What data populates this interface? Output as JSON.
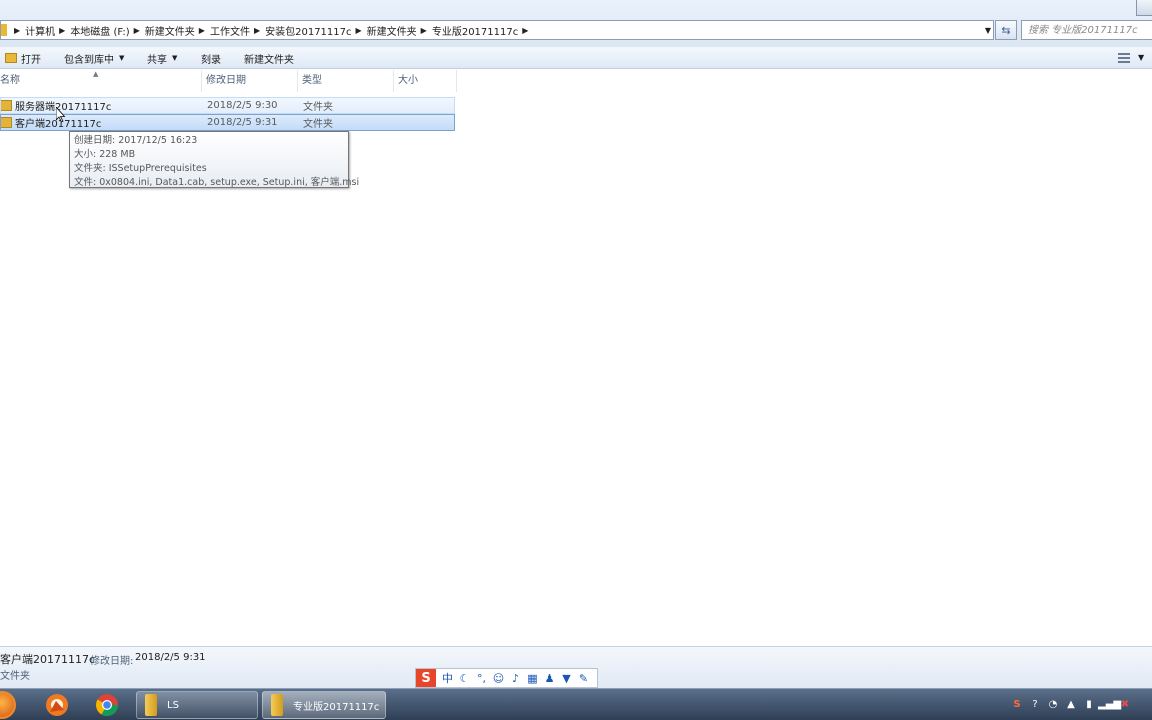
{
  "address_bar": {
    "crumbs": [
      "计算机",
      "本地磁盘 (F:)",
      "新建文件夹",
      "工作文件",
      "安装包20171117c",
      "新建文件夹",
      "专业版20171117c"
    ],
    "search_placeholder": "搜索 专业版20171117c"
  },
  "toolbar": {
    "open_label": "打开",
    "include_library_label": "包含到库中",
    "share_label": "共享",
    "burn_label": "刻录",
    "new_folder_label": "新建文件夹"
  },
  "columns": {
    "name": "名称",
    "date_modified": "修改日期",
    "type": "类型",
    "size": "大小"
  },
  "files": [
    {
      "name": "服务器端20171117c",
      "date": "2018/2/5 9:30",
      "type": "文件夹"
    },
    {
      "name": "客户端20171117c",
      "date": "2018/2/5 9:31",
      "type": "文件夹"
    }
  ],
  "tooltip": {
    "created": "创建日期: 2017/12/5 16:23",
    "size": "大小: 228 MB",
    "folders": "文件夹: ISSetupPrerequisites",
    "files": "文件: 0x0804.ini, Data1.cab, setup.exe, Setup.ini, 客户端.msi"
  },
  "details": {
    "name": "客户端20171117c",
    "date_label": "修改日期:",
    "date_value": "2018/2/5 9:31",
    "type": "文件夹"
  },
  "ime": {
    "logo": "S",
    "mode": "中"
  },
  "taskbar": {
    "tasks": [
      {
        "label": "LS"
      },
      {
        "label": "专业版20171117c"
      }
    ]
  },
  "colors": {
    "selection": "#c3dcf8",
    "hover": "#e3eefc",
    "taskbar": "#2f3f55"
  }
}
